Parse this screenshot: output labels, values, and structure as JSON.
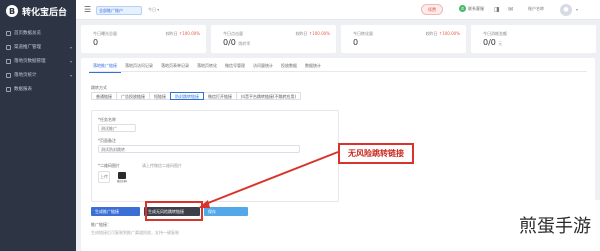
{
  "app": {
    "logo_letter": "B",
    "title": "转化宝后台"
  },
  "sidebar": {
    "items": [
      {
        "label": "首页数据总览",
        "icon": "home-icon"
      },
      {
        "label": "渠道推广管理",
        "icon": "megaphone-icon"
      },
      {
        "label": "落地页数据管理",
        "icon": "page-icon"
      },
      {
        "label": "落地页统计",
        "icon": "chart-icon"
      },
      {
        "label": "数据报表",
        "icon": "report-icon"
      }
    ]
  },
  "topbar": {
    "menu_icon": "☰",
    "account_select": "全部推广账户",
    "date_select": "今日 ▾",
    "renew_badge": "续费",
    "wechat_icon": "✆",
    "wechat_label": "联系客服",
    "util_icons": [
      "◨",
      "✉"
    ],
    "user_name": "账户名称",
    "avatar_icon": "●",
    "caret": "▾"
  },
  "stats": [
    {
      "label": "今日曝光总量",
      "value": "0",
      "delta_label": "较昨日",
      "delta": "↑100.00%"
    },
    {
      "label": "今日点击量",
      "value": "0/0",
      "value_sub": "跳转率",
      "delta_label": "较昨日",
      "delta": "↑100.00%"
    },
    {
      "label": "今日转化量",
      "value": "0",
      "delta_label": "较昨日",
      "delta": "↑100.00%"
    },
    {
      "label": "今日消耗金额",
      "value": "0/0",
      "value_sub": "元",
      "delta_label": "",
      "delta": ""
    }
  ],
  "panel": {
    "tabs": [
      {
        "label": "落地推广链接",
        "active": true
      },
      {
        "label": "落地页访问记录",
        "active": false
      },
      {
        "label": "落地页表单记录",
        "active": false
      },
      {
        "label": "落地页转化",
        "active": false
      },
      {
        "label": "微信号管理",
        "active": false
      },
      {
        "label": "访问量统计",
        "active": false
      },
      {
        "label": "投放数据",
        "active": false
      },
      {
        "label": "数据统计",
        "active": false
      }
    ],
    "section_label": "跳转方式",
    "subtabs": [
      {
        "label": "普通链接",
        "active": false
      },
      {
        "label": "广告投放链接",
        "active": false
      },
      {
        "label": "短链接",
        "active": false
      },
      {
        "label": "防封跳转链接",
        "active": true
      },
      {
        "label": "微信打开链接",
        "active": false
      },
      {
        "label": "抖音平台跳转链接(不跳转应用)",
        "active": false
      }
    ],
    "form": {
      "name_label": "*任务名称",
      "name_value": "测试推广",
      "remark_label": "*页面备注",
      "remark_value": "测试防封跳转",
      "qr_label": "*二维码图片",
      "qr_tip": "请上传微信二维码图片",
      "upload_label": "上传",
      "qr_caption": "微信扫码"
    },
    "buttons": {
      "b1": "生成推广链接",
      "b2": "生成无风险跳转链接",
      "b3": "保存"
    },
    "link_label": "推广链接：",
    "link_value": "生成链接后可复制到推广渠道投放，支持一键复制"
  },
  "annotation": {
    "callout_text": "无风险跳转链接"
  },
  "watermark": {
    "text": "煎蛋手游"
  },
  "colors": {
    "sidebar_bg": "#2d3544",
    "accent": "#2f6fde",
    "annotation": "#d9342b"
  }
}
